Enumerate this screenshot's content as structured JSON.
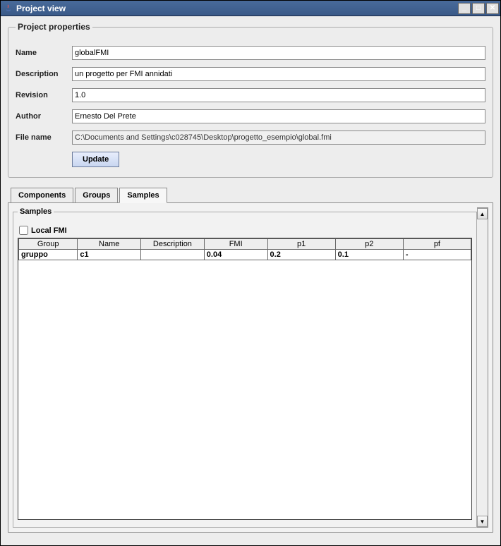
{
  "window": {
    "title": "Project view"
  },
  "properties": {
    "legend": "Project properties",
    "labels": {
      "name": "Name",
      "description": "Description",
      "revision": "Revision",
      "author": "Author",
      "filename": "File name"
    },
    "values": {
      "name": "globalFMI",
      "description": "un progetto per FMI annidati",
      "revision": "1.0",
      "author": "Ernesto Del Prete",
      "filename": "C:\\Documents and Settings\\c028745\\Desktop\\progetto_esempio\\global.fmi"
    },
    "update_label": "Update"
  },
  "tabs": {
    "components": "Components",
    "groups": "Groups",
    "samples": "Samples"
  },
  "samples": {
    "legend": "Samples",
    "local_fmi_label": "Local FMI",
    "columns": {
      "group": "Group",
      "name": "Name",
      "description": "Description",
      "fmi": "FMI",
      "p1": "p1",
      "p2": "p2",
      "pf": "pf"
    },
    "rows": [
      {
        "group": "gruppo",
        "name": "c1",
        "description": "",
        "fmi": "0.04",
        "p1": "0.2",
        "p2": "0.1",
        "pf": "-"
      }
    ]
  }
}
